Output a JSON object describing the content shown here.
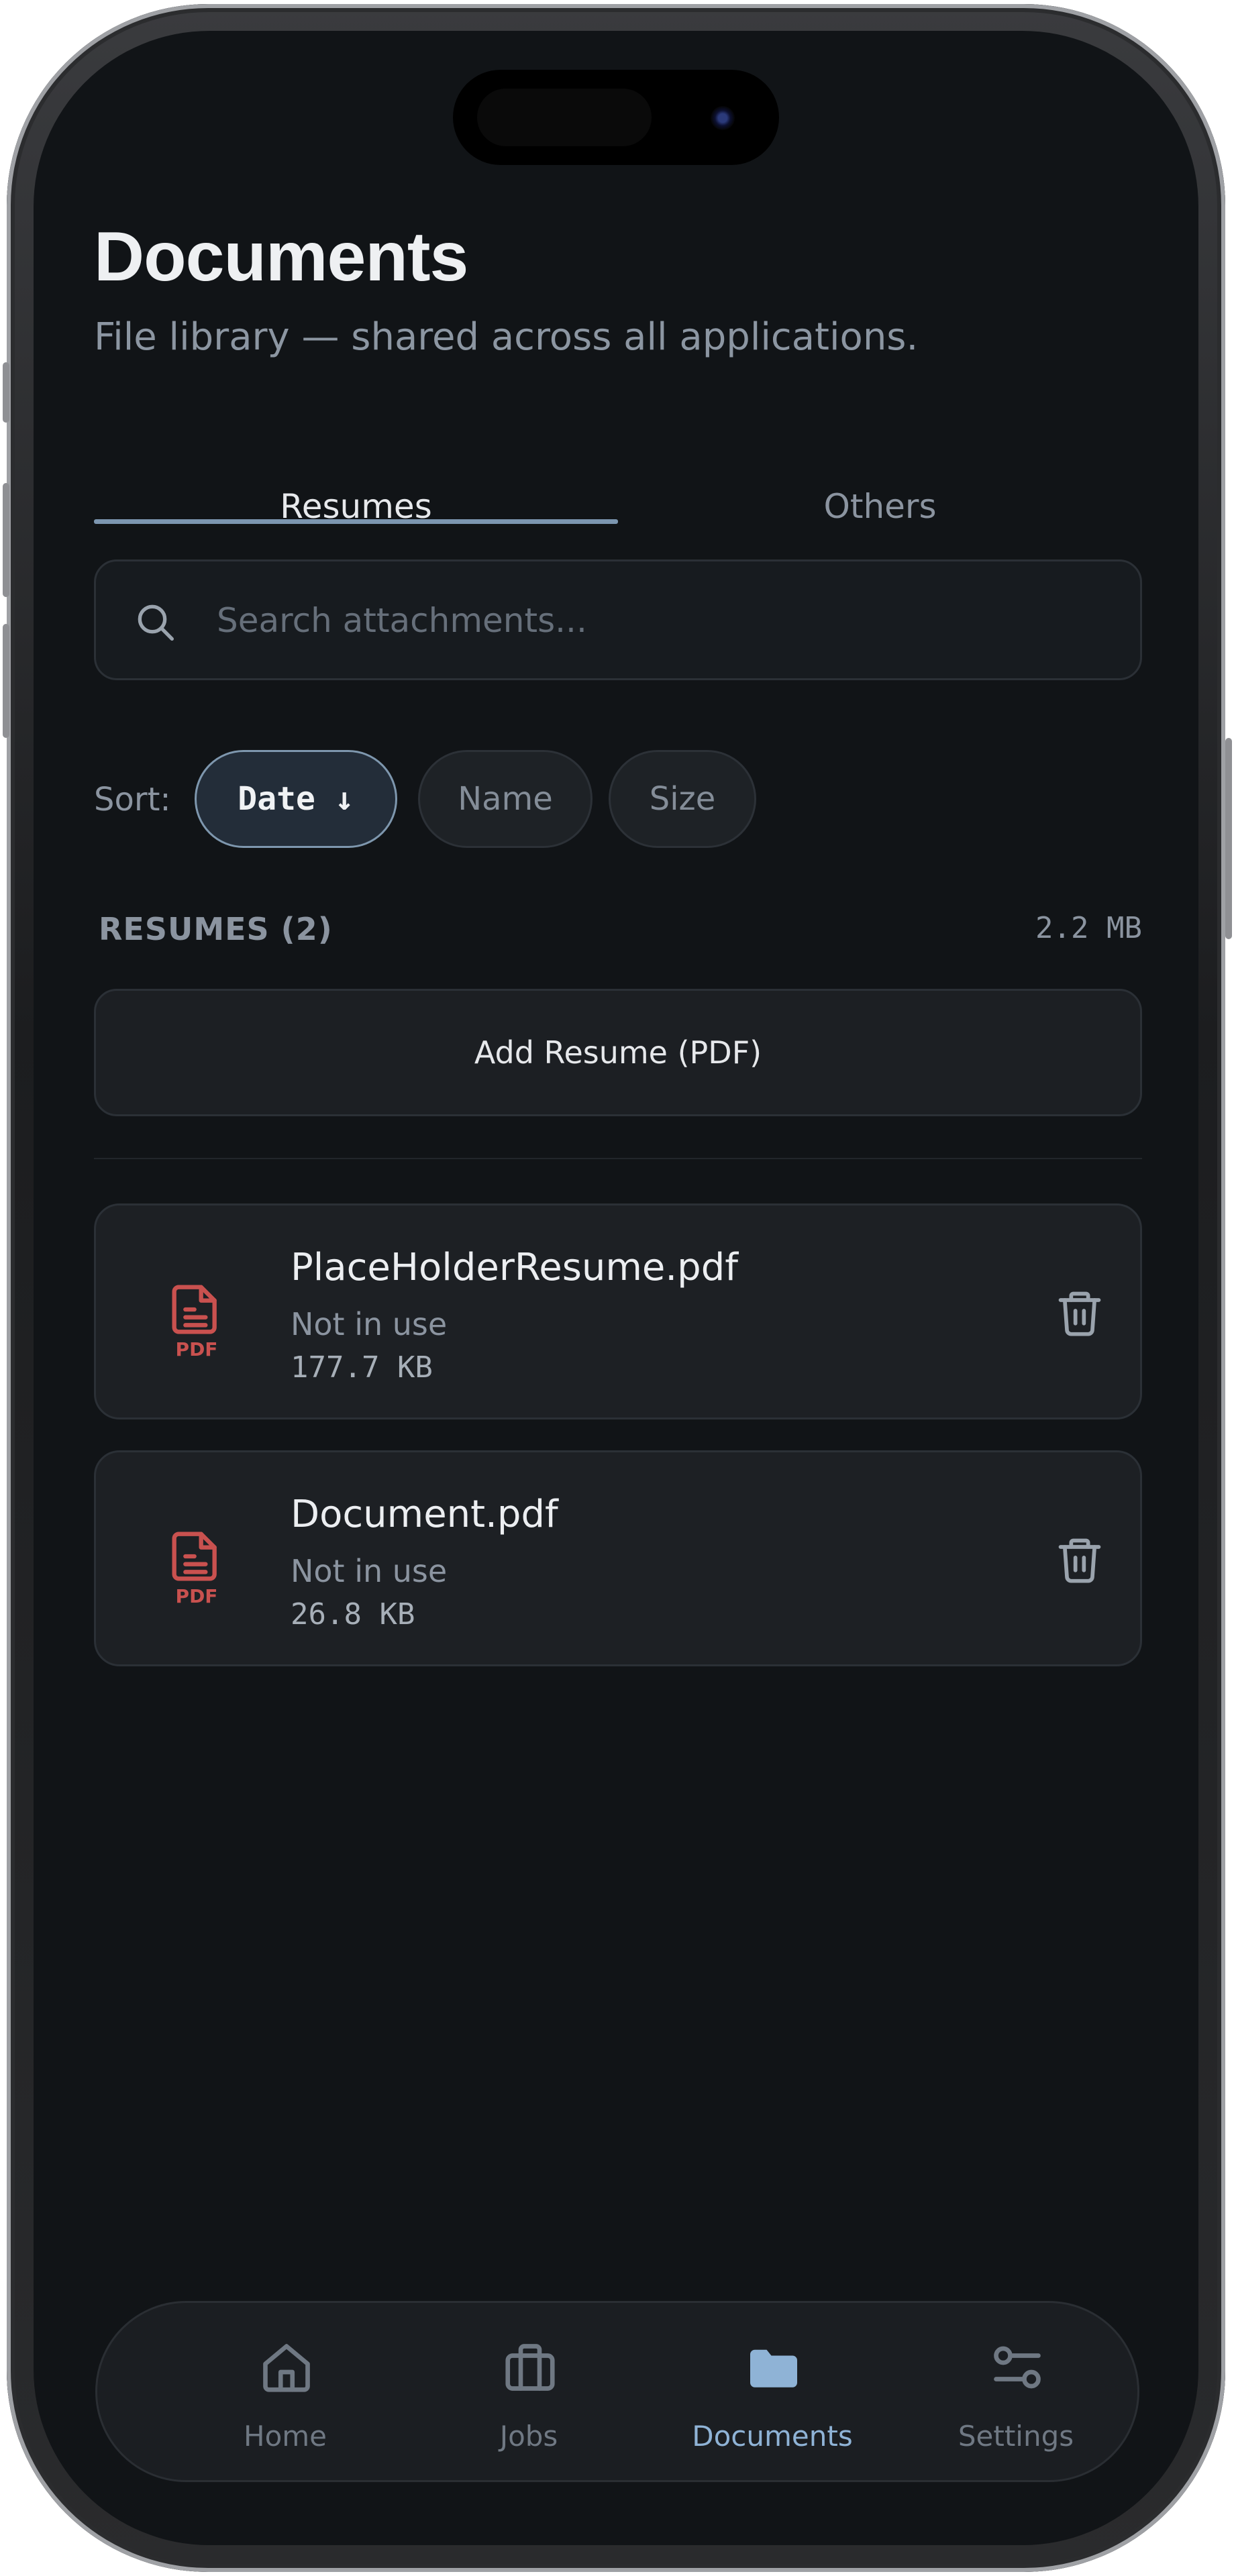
{
  "header": {
    "title": "Documents",
    "subtitle": "File library — shared across all applications."
  },
  "tabs": [
    {
      "label": "Resumes",
      "active": true
    },
    {
      "label": "Others",
      "active": false
    }
  ],
  "search": {
    "placeholder": "Search attachments...",
    "value": ""
  },
  "sort": {
    "label": "Sort:",
    "options": [
      {
        "label": "Date ↓",
        "active": true
      },
      {
        "label": "Name",
        "active": false
      },
      {
        "label": "Size",
        "active": false
      }
    ]
  },
  "section": {
    "label": "RESUMES (2)",
    "total_size": "2.2 MB"
  },
  "add_button": {
    "label": "Add Resume (PDF)"
  },
  "files": [
    {
      "name": "PlaceHolderResume.pdf",
      "status": "Not in use",
      "size": "177.7 KB",
      "type_tag": "PDF"
    },
    {
      "name": "Document.pdf",
      "status": "Not in use",
      "size": "26.8 KB",
      "type_tag": "PDF"
    }
  ],
  "nav": [
    {
      "label": "Home",
      "icon": "home-icon",
      "active": false
    },
    {
      "label": "Jobs",
      "icon": "briefcase-icon",
      "active": false
    },
    {
      "label": "Documents",
      "icon": "folder-icon",
      "active": true
    },
    {
      "label": "Settings",
      "icon": "sliders-icon",
      "active": false
    }
  ],
  "colors": {
    "background": "#111417",
    "accent": "#8fb3d6",
    "tab_underline": "#7c96b0",
    "pdf_icon": "#c9514f"
  }
}
